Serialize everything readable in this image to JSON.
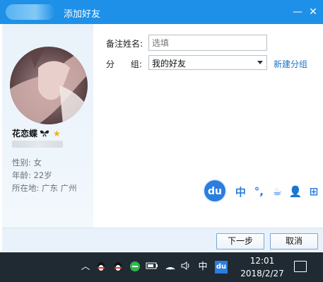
{
  "window": {
    "title": "添加好友",
    "minimize_glyph": "—",
    "close_glyph": "✕"
  },
  "profile": {
    "nickname": "花恋蝶",
    "gender": "性别: 女",
    "age": "年龄: 22岁",
    "location": "所在地: 广东  广州"
  },
  "form": {
    "remark_label": "备注姓名:",
    "remark_placeholder": "选填",
    "group_label": "分      组:",
    "group_value": "我的好友",
    "new_group_link": "新建分组"
  },
  "ime": {
    "logo": "du",
    "tools": [
      "中",
      "°,",
      "☕",
      "👤",
      "⊞"
    ]
  },
  "buttons": {
    "next": "下一步",
    "cancel": "取消"
  },
  "taskbar": {
    "ime_lang": "中",
    "time": "12:01",
    "date": "2018/2/27"
  },
  "colors": {
    "titlebar": "#1e90e8",
    "link": "#1a73c9",
    "ime_blue": "#2b7de0",
    "taskbar": "#1f2a33"
  }
}
